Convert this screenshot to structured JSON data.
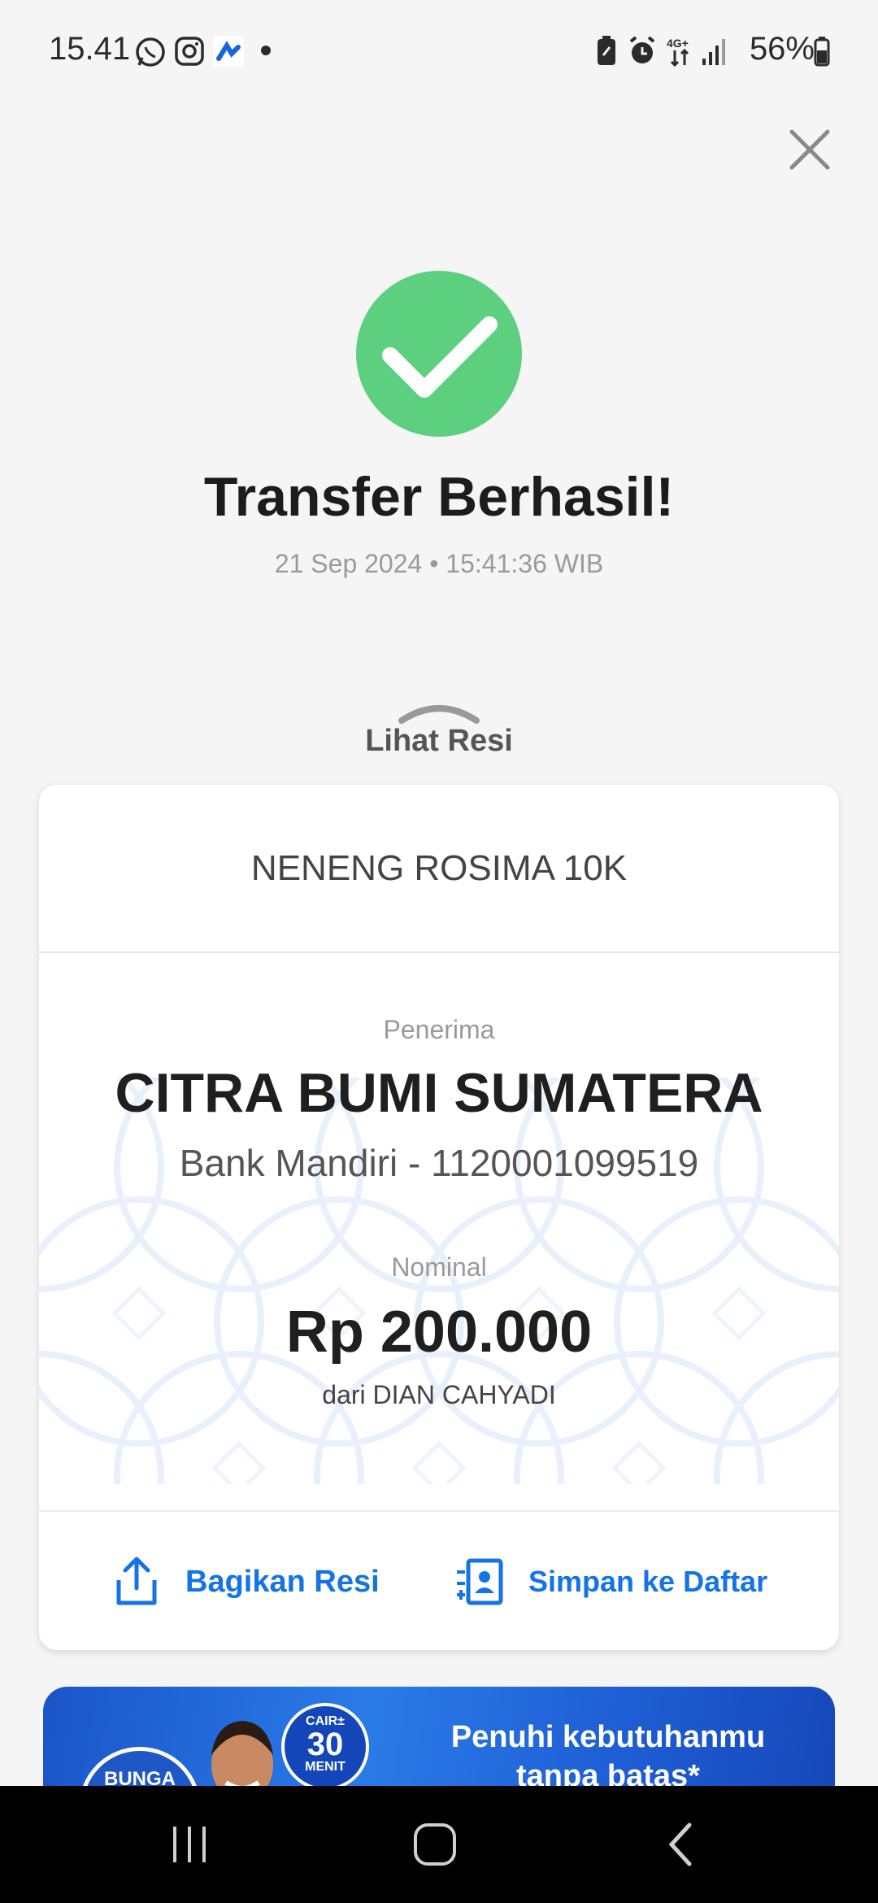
{
  "status_bar": {
    "time": "15.41",
    "left_icons": [
      "whatsapp-icon",
      "instagram-icon",
      "app-icon",
      "dot-icon"
    ],
    "right_icons": [
      "battery-saver-icon",
      "alarm-icon",
      "network-4g-icon",
      "signal-icon"
    ],
    "battery_label": "56%"
  },
  "header": {
    "title": "Transfer Berhasil!",
    "datetime": "21 Sep 2024 • 15:41:36 WIB"
  },
  "receipt_toggle": {
    "label": "Lihat Resi"
  },
  "receipt": {
    "note": "NENENG ROSIMA 10K",
    "recipient_label": "Penerima",
    "recipient_name": "CITRA BUMI SUMATERA",
    "recipient_bank": "Bank Mandiri - 1120001099519",
    "amount_label": "Nominal",
    "amount": "Rp 200.000",
    "sender": "dari DIAN CAHYADI"
  },
  "actions": {
    "share_label": "Bagikan Resi",
    "save_label": "Simpan ke Daftar"
  },
  "banner": {
    "badge_text": "BUNGA",
    "cair_small": "CAIR±",
    "cair_number": "30",
    "cair_unit": "MENIT",
    "headline_line1": "Penuhi kebutuhanmu",
    "headline_line2": "tanpa batas*"
  },
  "colors": {
    "success": "#5cd07f",
    "accent": "#1473e6",
    "background": "#f5f5f5"
  }
}
